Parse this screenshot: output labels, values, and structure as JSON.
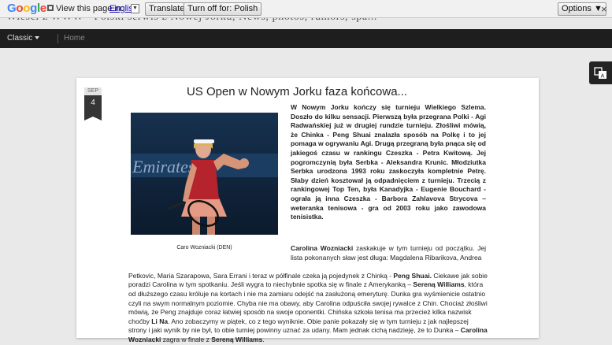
{
  "translate_bar": {
    "logo": "Google",
    "prompt": "View this page in:",
    "language": "English",
    "translate_label": "Translate",
    "turn_off_label": "Turn off for: Polish",
    "options_label": "Options ▼",
    "close_symbol": "×"
  },
  "blog": {
    "title": "Wiesci z WWW - Polski serwis z Nowej Jorku, News, photos, rumors, spa..."
  },
  "nav": {
    "classic_label": "Classic",
    "home_label": "Home"
  },
  "post": {
    "date_month": "SEP",
    "date_day": "4",
    "title": "US Open w Nowym Jorku faza końcowa...",
    "photo_caption": "Caro Wozniacki (DEN)",
    "photo_banner_text": "Emirates",
    "para1": "W Nowym Jorku kończy się turnieju Wielkiego Szlema. Doszło do kilku sensacji. Pierwszą była przegrana Polki - Agi Radwańskiej już w drugiej rundzie turnieju. Złośliwi mówią, że Chinka - Peng Shuai znalazła sposób na Polkę i to jej pomaga w ogrywaniu Agi. Drugą przegraną była pnąca się od jakiegoś czasu w rankingu Czeszka - Petra Kwitową. Jej pogromczynią była Serbka - Aleksandra Krunic. Młodziutka Serbka urodzona 1993 roku zaskoczyła kompletnie Petrę. Słaby dzień kosztował ją odpadnięciem z turnieju. Trzecią z rankingowej Top Ten, była Kanadyjka - Eugenie Bouchard - ograła ją inna Czeszka - Barbora Zahlavova Strycova – weteranka tenisowa - gra od 2003 roku jako zawodowa tenisistka.",
    "para2_name": "Carolina Wozniacki",
    "para2_a": " zaskakuje w tym turnieju od początku. Jej lista pokonanych sław jest długa:  Magdalena Ribarikova, Andrea",
    "para2_b1": "Petkovic, Maria Szarapowa, Sara Errani i teraz w półfinale czeka ją pojedynek z Chinką - ",
    "para2_peng": "Peng Shuai.",
    "para2_b2": " Ciekawe jak sobie poradzi Carolina w tym spotkaniu. Jeśli wygra to niechybnie spotka się w finale z Amerykanką – ",
    "para2_serena": "Sereną Williams",
    "para2_b3": ", która od dłuższego czasu króluje na kortach i nie ma zamiaru odejść na zasłużoną emeryturę. Dunka gra wyśmienicie ostatnio czyli na swym normalnym poziomie. Chyba nie ma obawy, aby Carolina odpuściła swojej rywalce z Chin. Chociaż złośliwi mówią, że Peng znajduje coraz łatwiej sposób na swoje oponentki.  Chińska szkoła tenisa ma przecież kilka nazwisk choćby ",
    "para2_lina": "Li Na",
    "para2_b4": ". Ano zobaczymy w piątek, co z tego wyniknie. Obie panie pokazały się w tym turnieju z jak najlepszej strony i jaki wynik by nie był, to obie turniej powinny uznać za udany. Mam jednak cichą nadzieję, że to Dunka – ",
    "para2_final_name": "Carolina Wozniacki",
    "para2_b5": " zagra w finale z ",
    "para2_final_serena": "Sereną Williams",
    "para2_b6": "."
  },
  "colors": {
    "nav_bg": "#1e1e1e",
    "page_bg": "#e9e9e9",
    "link": "#1a0dab"
  }
}
